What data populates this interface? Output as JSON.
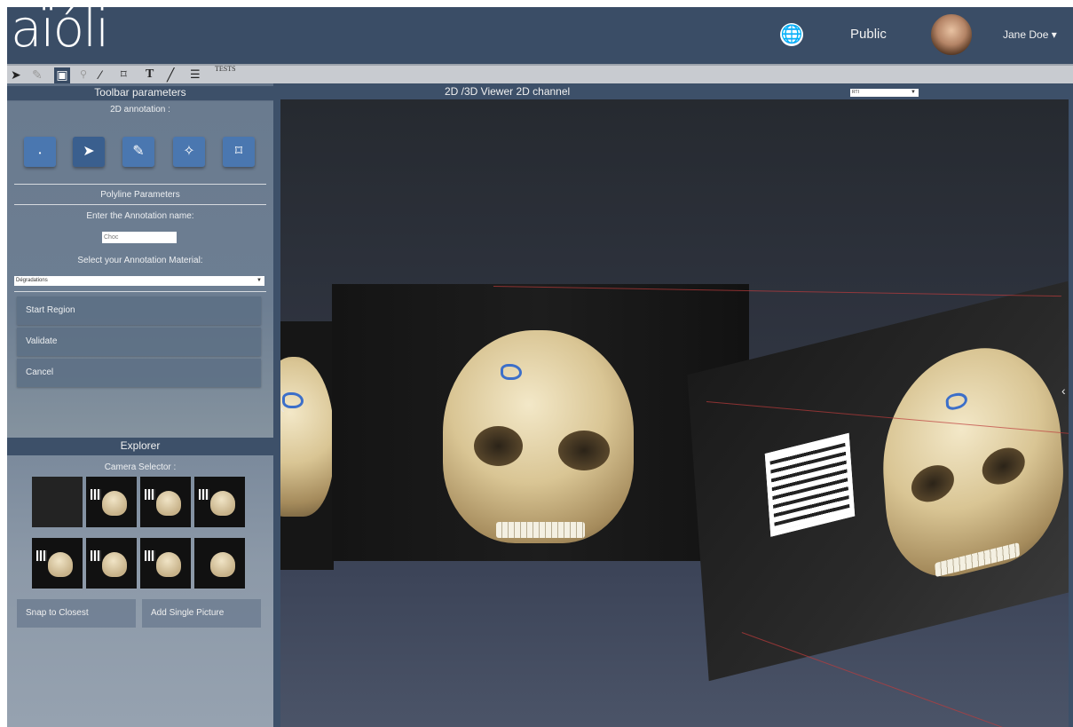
{
  "header": {
    "logo_text": "aïóli",
    "visibility_label": "Public",
    "user_name": "Jane Doe ▾",
    "globe_icon": "globe-icon"
  },
  "tool_strip": {
    "tools": [
      "pointer-icon",
      "pin-icon",
      "image-icon",
      "magnifier-icon",
      "magic-wand-icon",
      "polygon-icon",
      "text-icon",
      "line-icon",
      "settings-sliders-icon"
    ],
    "active_tool": "image-icon",
    "tests_label": "TESTS"
  },
  "toolbar_panel": {
    "title": "Toolbar parameters",
    "annotation_label": "2D annotation :",
    "annotation_tools": [
      "point-tool-icon",
      "polyline-tool-icon",
      "brush-tool-icon",
      "magic-wand-tool-icon",
      "region-tool-icon"
    ],
    "polyline_title": "Polyline Parameters",
    "enter_name_label": "Enter the Annotation name:",
    "annotation_name_value": "Choc",
    "material_label": "Select your Annotation Material:",
    "material_value": "Dégradations",
    "start_region": "Start Region",
    "validate": "Validate",
    "cancel": "Cancel"
  },
  "explorer": {
    "title": "Explorer",
    "camera_selector_label": "Camera Selector :",
    "snap_button": "Snap to Closest",
    "add_button": "Add Single Picture"
  },
  "viewer": {
    "title": "2D /3D Viewer 2D channel",
    "channel_value": "RTI"
  },
  "colors": {
    "header_bg": "#3a4d66",
    "annotation_blue": "#3c6fc9",
    "button_blue": "#4a77b0"
  }
}
